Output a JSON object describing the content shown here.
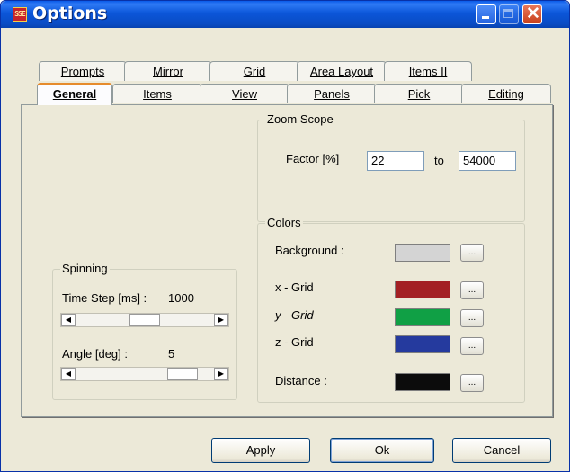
{
  "window": {
    "title": "Options",
    "icon": "app-logo-icon",
    "icon_text": "SSE"
  },
  "tabs_back": [
    {
      "label": "Prompts"
    },
    {
      "label": "Mirror"
    },
    {
      "label": "Grid"
    },
    {
      "label": "Area Layout"
    },
    {
      "label": "Items II"
    }
  ],
  "tabs_front": [
    {
      "label": "General",
      "active": true
    },
    {
      "label": "Items"
    },
    {
      "label": "View"
    },
    {
      "label": "Panels"
    },
    {
      "label": "Pick"
    },
    {
      "label": "Editing"
    }
  ],
  "zoom": {
    "title": "Zoom Scope",
    "factor_label": "Factor [%]",
    "from": "22",
    "to_label": "to",
    "to": "54000"
  },
  "colors": {
    "title": "Colors",
    "rows": [
      {
        "label": "Background :",
        "color": "#d4d4d4"
      },
      {
        "label": "x - Grid",
        "color": "#a32024"
      },
      {
        "label": "y - Grid",
        "color": "#10a045"
      },
      {
        "label": "z - Grid",
        "color": "#253a9e"
      },
      {
        "label": "Distance :",
        "color": "#0c0c0c"
      }
    ],
    "button_label": "..."
  },
  "spinning": {
    "title": "Spinning",
    "time_step_label": "Time Step [ms] :",
    "time_step_value": "1000",
    "time_step_position": 0.5,
    "angle_label": "Angle [deg] :",
    "angle_value": "5",
    "angle_position": 0.85
  },
  "buttons": {
    "apply": "Apply",
    "ok": "Ok",
    "cancel": "Cancel"
  }
}
